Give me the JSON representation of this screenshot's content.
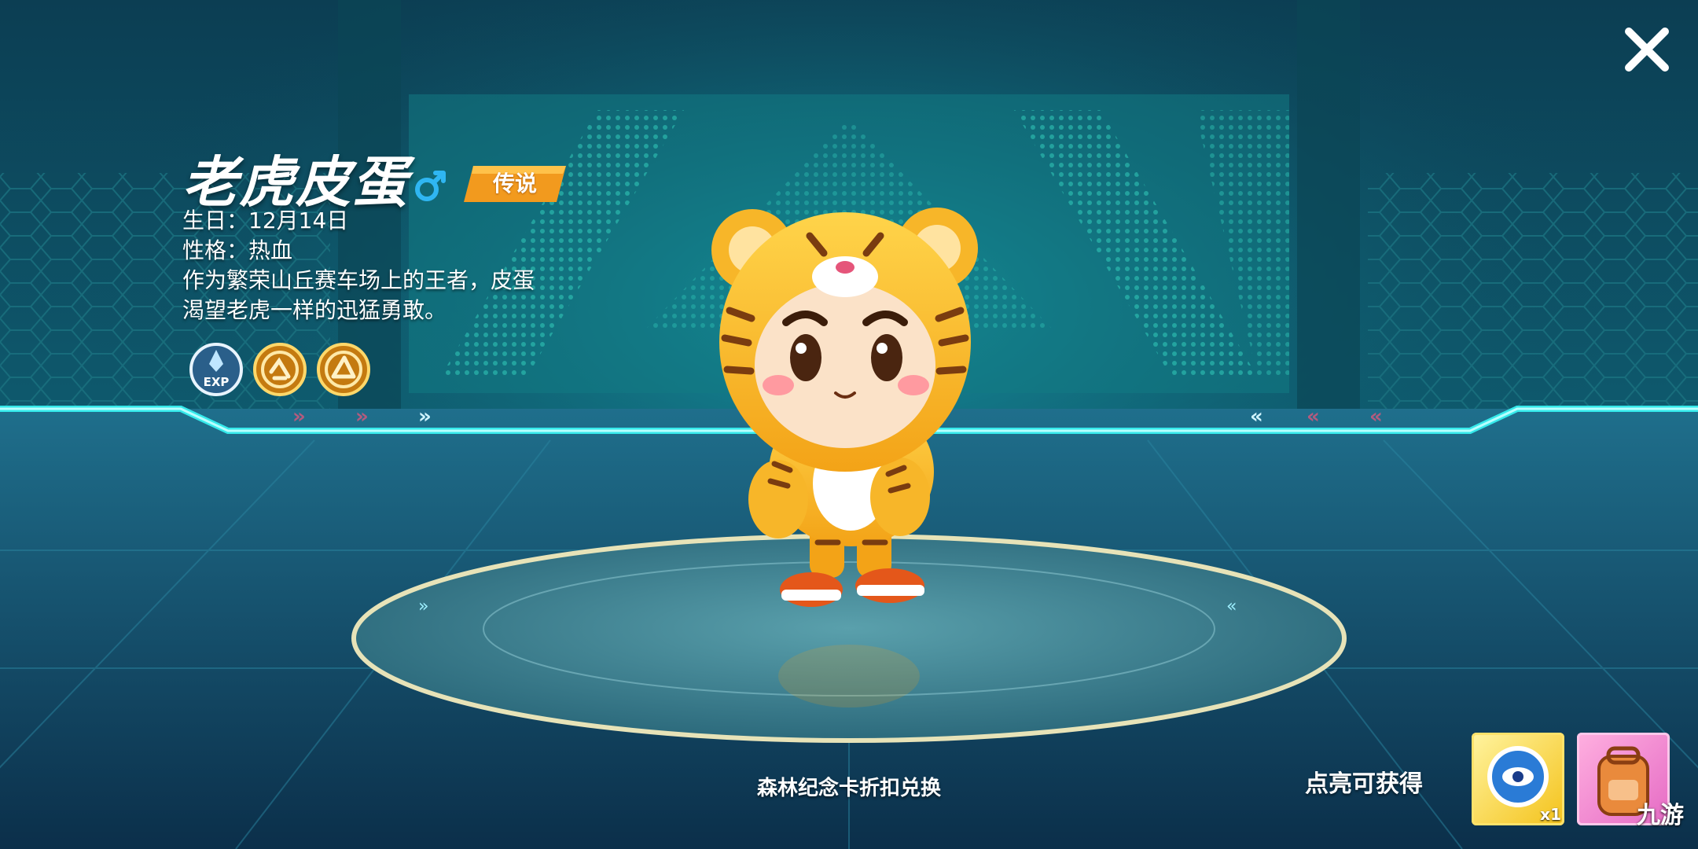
{
  "character": {
    "name": "老虎皮蛋",
    "gender_icon": "male-symbol-icon",
    "rarity": "传说",
    "birthday": "生日：12月14日",
    "personality": "性格：热血",
    "description_line1": "作为繁荣山丘赛车场上的王者，皮蛋",
    "description_line2": "渴望老虎一样的迅猛勇敢。"
  },
  "skills": [
    {
      "icon": "exp-boost-icon",
      "label": "EXP"
    },
    {
      "icon": "gold-skill-icon-1"
    },
    {
      "icon": "gold-skill-icon-2"
    }
  ],
  "footer": {
    "exchange_text": "森林纪念卡折扣兑换",
    "unlock_label": "点亮可获得",
    "reward_1_count": "x1"
  },
  "watermark": "九游",
  "colors": {
    "rarity_badge": "#f29a1e",
    "gender_icon": "#2fb6f2",
    "glow_cyan": "#37f0f0",
    "platform_rim": "#e7e3b8"
  }
}
